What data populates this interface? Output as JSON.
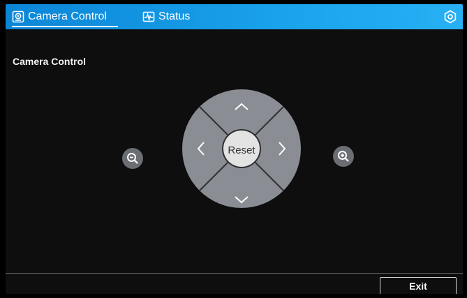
{
  "tabs": [
    {
      "label": "Camera Control",
      "icon": "camera-icon",
      "active": true
    },
    {
      "label": "Status",
      "icon": "pulse-icon",
      "active": false
    }
  ],
  "header": {
    "settings_icon": "gear-icon"
  },
  "main": {
    "section_title": "Camera Control",
    "reset_label": "Reset",
    "directions": [
      "up",
      "down",
      "left",
      "right"
    ],
    "zoom_out_icon": "zoom-out-icon",
    "zoom_in_icon": "zoom-in-icon"
  },
  "footer": {
    "exit_label": "Exit"
  },
  "colors": {
    "topbar": "#1a9ce6",
    "dpad": "#8a8d93",
    "reset": "#e3e3e3",
    "background": "#0e0e0e"
  }
}
